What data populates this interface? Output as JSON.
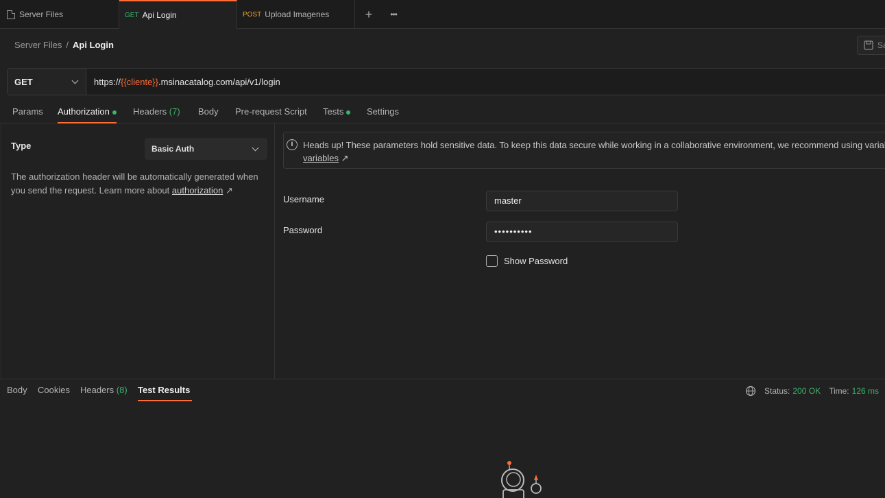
{
  "tabs": [
    {
      "method": "",
      "label": "Server Files"
    },
    {
      "method": "GET",
      "label": "Api Login"
    },
    {
      "method": "POST",
      "label": "Upload Imagenes"
    }
  ],
  "tab_actions": {
    "new": "+",
    "more": "•••"
  },
  "breadcrumb": {
    "parent": "Server Files",
    "separator": "/",
    "current": "Api Login"
  },
  "save_label": "Sa",
  "request": {
    "method": "GET",
    "url_prefix": "https://",
    "url_variable": "{{cliente}}",
    "url_suffix": ".msinacatalog.com/api/v1/login"
  },
  "request_tabs": {
    "params": "Params",
    "authorization": "Authorization",
    "headers": "Headers",
    "headers_count": "(7)",
    "body": "Body",
    "prerequest": "Pre-request Script",
    "tests": "Tests",
    "settings": "Settings"
  },
  "auth": {
    "type_label": "Type",
    "type_value": "Basic Auth",
    "description": "The authorization header will be automatically generated when you send the request. Learn more about ",
    "description_link": "authorization",
    "link_arrow": "↗"
  },
  "banner": {
    "text": "Heads up! These parameters hold sensitive data. To keep this data secure while working in a collaborative environment, we recommend using variables.",
    "link": "variables",
    "link_arrow": "↗"
  },
  "fields": {
    "username_label": "Username",
    "username_value": "master",
    "password_label": "Password",
    "password_value": "••••••••••",
    "show_password_label": "Show Password"
  },
  "response_tabs": {
    "body": "Body",
    "cookies": "Cookies",
    "headers": "Headers",
    "headers_count": "(8)",
    "test_results": "Test Results"
  },
  "status": {
    "status_label": "Status:",
    "status_value": "200 OK",
    "time_label": "Time:",
    "time_value": "126 ms"
  },
  "colors": {
    "accent": "#ff6c37",
    "success": "#3bb36a",
    "post": "#f0a030"
  }
}
